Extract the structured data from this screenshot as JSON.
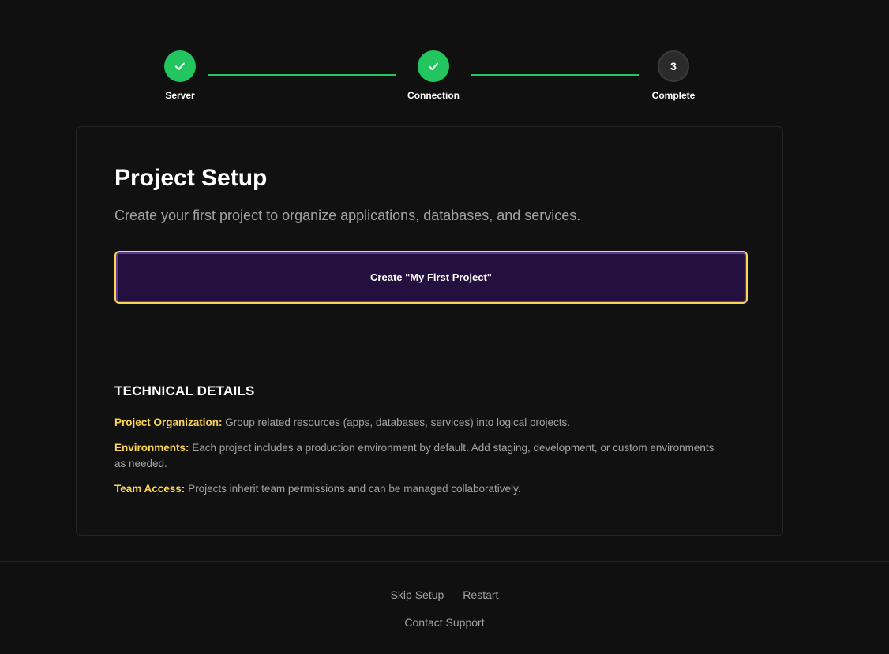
{
  "stepper": {
    "steps": [
      {
        "label": "Server",
        "status": "complete",
        "icon": "check-icon"
      },
      {
        "label": "Connection",
        "status": "complete",
        "icon": "check-icon"
      },
      {
        "label": "Complete",
        "status": "current",
        "number": "3"
      }
    ],
    "accent_color": "#22c55e"
  },
  "card": {
    "title": "Project Setup",
    "subtitle": "Create your first project to organize applications, databases, and services.",
    "create_button_label": "Create \"My First Project\"",
    "details": {
      "heading": "TECHNICAL DETAILS",
      "items": [
        {
          "key": "Project Organization:",
          "text": " Group related resources (apps, databases, services) into logical projects."
        },
        {
          "key": "Environments:",
          "text": " Each project includes a production environment by default. Add staging, development, or custom environments as needed."
        },
        {
          "key": "Team Access:",
          "text": " Projects inherit team permissions and can be managed collaboratively."
        }
      ]
    },
    "highlight_color": "#fcd452",
    "button_bg": "#23103f"
  },
  "footer": {
    "skip_label": "Skip Setup",
    "restart_label": "Restart",
    "support_label": "Contact Support"
  }
}
